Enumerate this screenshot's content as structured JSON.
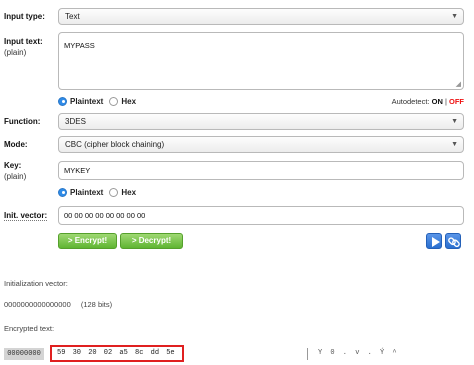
{
  "input_type": {
    "label": "Input type:",
    "value": "Text"
  },
  "input_text": {
    "label": "Input text:",
    "sublabel": "(plain)",
    "value": "MYPASS"
  },
  "input_format": {
    "plaintext": "Plaintext",
    "hex": "Hex",
    "selected": "Plaintext"
  },
  "autodetect": {
    "label": "Autodetect:",
    "on": "ON",
    "sep": "|",
    "off": "OFF"
  },
  "function": {
    "label": "Function:",
    "value": "3DES"
  },
  "mode": {
    "label": "Mode:",
    "value": "CBC (cipher block chaining)"
  },
  "key": {
    "label": "Key:",
    "sublabel": "(plain)",
    "value": "MYKEY"
  },
  "key_format": {
    "plaintext": "Plaintext",
    "hex": "Hex",
    "selected": "Plaintext"
  },
  "iv": {
    "label": "Init. vector:",
    "value": "00 00 00 00 00 00 00 00"
  },
  "buttons": {
    "encrypt": "> Encrypt!",
    "decrypt": "> Decrypt!"
  },
  "output": {
    "iv_label": "Initialization vector:",
    "iv_value": "0000000000000000",
    "iv_bits": "(128 bits)",
    "enc_label": "Encrypted text:",
    "hex_address": "00000000",
    "hex_bytes": "59 30 20 02 a5 8c dd 5e",
    "ascii": "Y 0   . v . Ý ^"
  },
  "colors": {
    "accent_green": "#5fb532",
    "accent_blue": "#2a6fcf",
    "highlight_red": "#e02020",
    "off_red": "#e11111"
  }
}
